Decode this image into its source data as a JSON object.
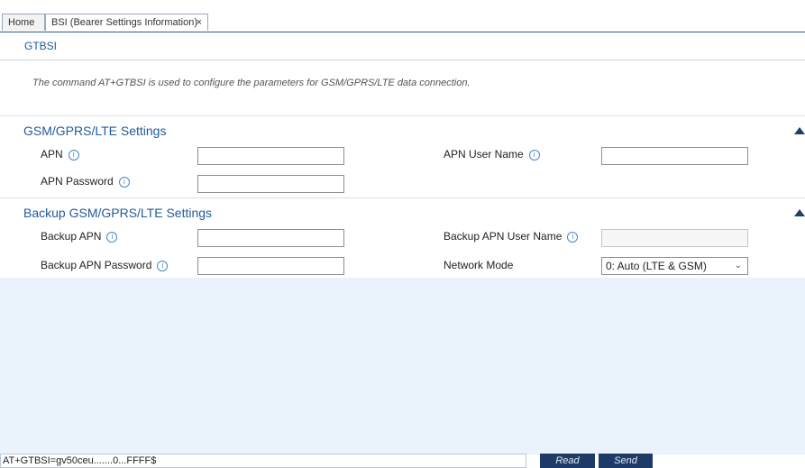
{
  "tabs": [
    {
      "label": "Home"
    },
    {
      "label": "BSI (Bearer Settings Information)",
      "close_icon": "×"
    }
  ],
  "page_title": "GTBSI",
  "description": "The command AT+GTBSI is used to configure the parameters for GSM/GPRS/LTE data connection.",
  "info_icon": "i",
  "sections": {
    "primary": {
      "title": "GSM/GPRS/LTE Settings",
      "fields": {
        "apn": {
          "label": "APN",
          "value": ""
        },
        "apn_user_name": {
          "label": "APN User Name",
          "value": ""
        },
        "apn_password": {
          "label": "APN Password",
          "value": ""
        }
      }
    },
    "backup": {
      "title": "Backup GSM/GPRS/LTE Settings",
      "fields": {
        "backup_apn": {
          "label": "Backup APN",
          "value": ""
        },
        "backup_apn_user_name": {
          "label": "Backup APN User Name",
          "value": ""
        },
        "backup_apn_password": {
          "label": "Backup APN Password",
          "value": ""
        },
        "network_mode": {
          "label": "Network Mode",
          "value": "0: Auto (LTE & GSM)"
        }
      }
    }
  },
  "command": {
    "value": "AT+GTBSI=gv50ceu.......0...FFFF$",
    "read_label": "Read",
    "send_label": "Send"
  },
  "colors": {
    "accent": "#1f5b99",
    "button_bg": "#1d3b66",
    "panel_bg": "#eaf3fb"
  }
}
